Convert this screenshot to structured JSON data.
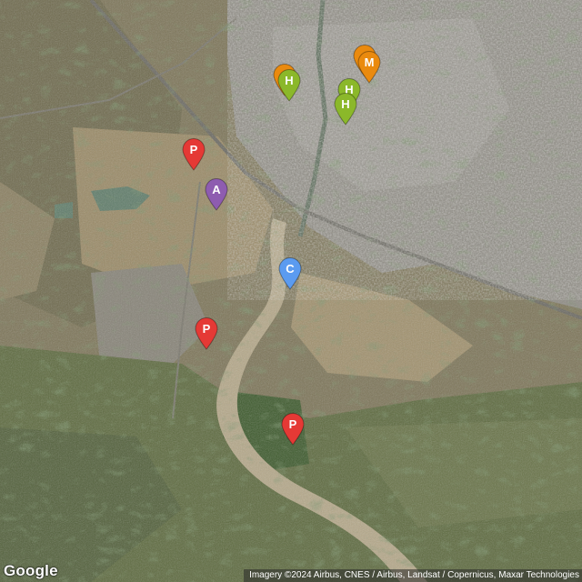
{
  "map": {
    "type": "satellite",
    "logo": "Google",
    "attribution": "Imagery ©2024 Airbus, CNES / Airbus, Landsat / Copernicus, Maxar Technologies",
    "markers": [
      {
        "label": "P",
        "color": "#e53935"
      },
      {
        "label": "A",
        "color": "#8e5cb0"
      },
      {
        "label": "C",
        "color": "#5b9bf0"
      },
      {
        "label": "P",
        "color": "#e53935"
      },
      {
        "label": "P",
        "color": "#e53935"
      },
      {
        "label": "H",
        "color": "#8bb82a"
      },
      {
        "label": "H",
        "color": "#8bb82a"
      },
      {
        "label": "H",
        "color": "#8bb82a"
      },
      {
        "label": "M",
        "color": "#ea8a0e"
      },
      {
        "label": "",
        "color": "#ea8a0e"
      },
      {
        "label": "",
        "color": "#ea8a0e"
      }
    ]
  }
}
